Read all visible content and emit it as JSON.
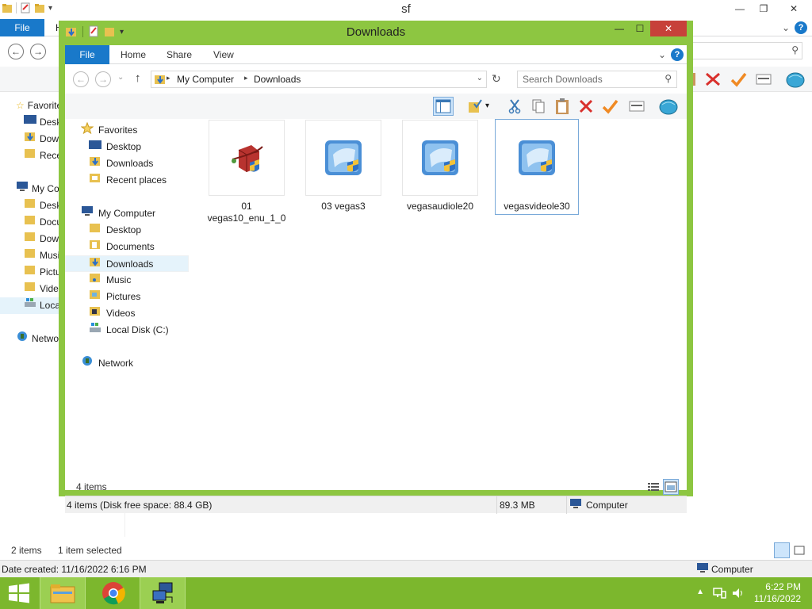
{
  "background_window": {
    "title": "sf",
    "file_tab": "File",
    "tab_partial": "H",
    "nav": {
      "favorites": "Favorites",
      "desktop": "Desktop",
      "downloads": "Downloads",
      "recent": "Recent places",
      "mycomputer": "My Computer",
      "desktop2": "Desktop",
      "documents": "Documents",
      "downloads2": "Downloads",
      "music": "Music",
      "pictures": "Pictures",
      "videos": "Videos",
      "localdisk": "Local Disk (C:)",
      "network": "Network"
    },
    "status": {
      "items": "2 items",
      "selected": "1 item selected"
    },
    "details": {
      "date_created": "Date created: 11/16/2022 6:16 PM",
      "location": "Computer"
    }
  },
  "window": {
    "title": "Downloads",
    "tabs": {
      "file": "File",
      "home": "Home",
      "share": "Share",
      "view": "View"
    },
    "address": {
      "root": "My Computer",
      "folder": "Downloads"
    },
    "search_placeholder": "Search Downloads",
    "nav": {
      "favorites": "Favorites",
      "desktop": "Desktop",
      "downloads": "Downloads",
      "recent": "Recent places",
      "mycomputer": "My Computer",
      "desktop2": "Desktop",
      "documents": "Documents",
      "downloads2": "Downloads",
      "music": "Music",
      "pictures": "Pictures",
      "videos": "Videos",
      "localdisk": "Local Disk (C:)",
      "network": "Network"
    },
    "files": [
      {
        "line1": "01",
        "line2": "vegas10_enu_1_0",
        "icon": "installer-package-icon"
      },
      {
        "line1": "03 vegas3",
        "line2": "",
        "icon": "vegas-installer-icon"
      },
      {
        "line1": "vegasaudiole20",
        "line2": "",
        "icon": "vegas-installer-icon"
      },
      {
        "line1": "vegasvideole30",
        "line2": "",
        "icon": "vegas-installer-icon"
      }
    ],
    "items_count": "4 items",
    "status": {
      "summary": "4 items (Disk free space: 88.4 GB)",
      "size": "89.3 MB",
      "location": "Computer"
    }
  },
  "taskbar": {
    "time": "6:22 PM",
    "date": "11/16/2022"
  },
  "colors": {
    "window_frame": "#8dc641",
    "taskbar": "#7cb72d",
    "accent_blue": "#1979ca",
    "close_red": "#c7413a"
  }
}
